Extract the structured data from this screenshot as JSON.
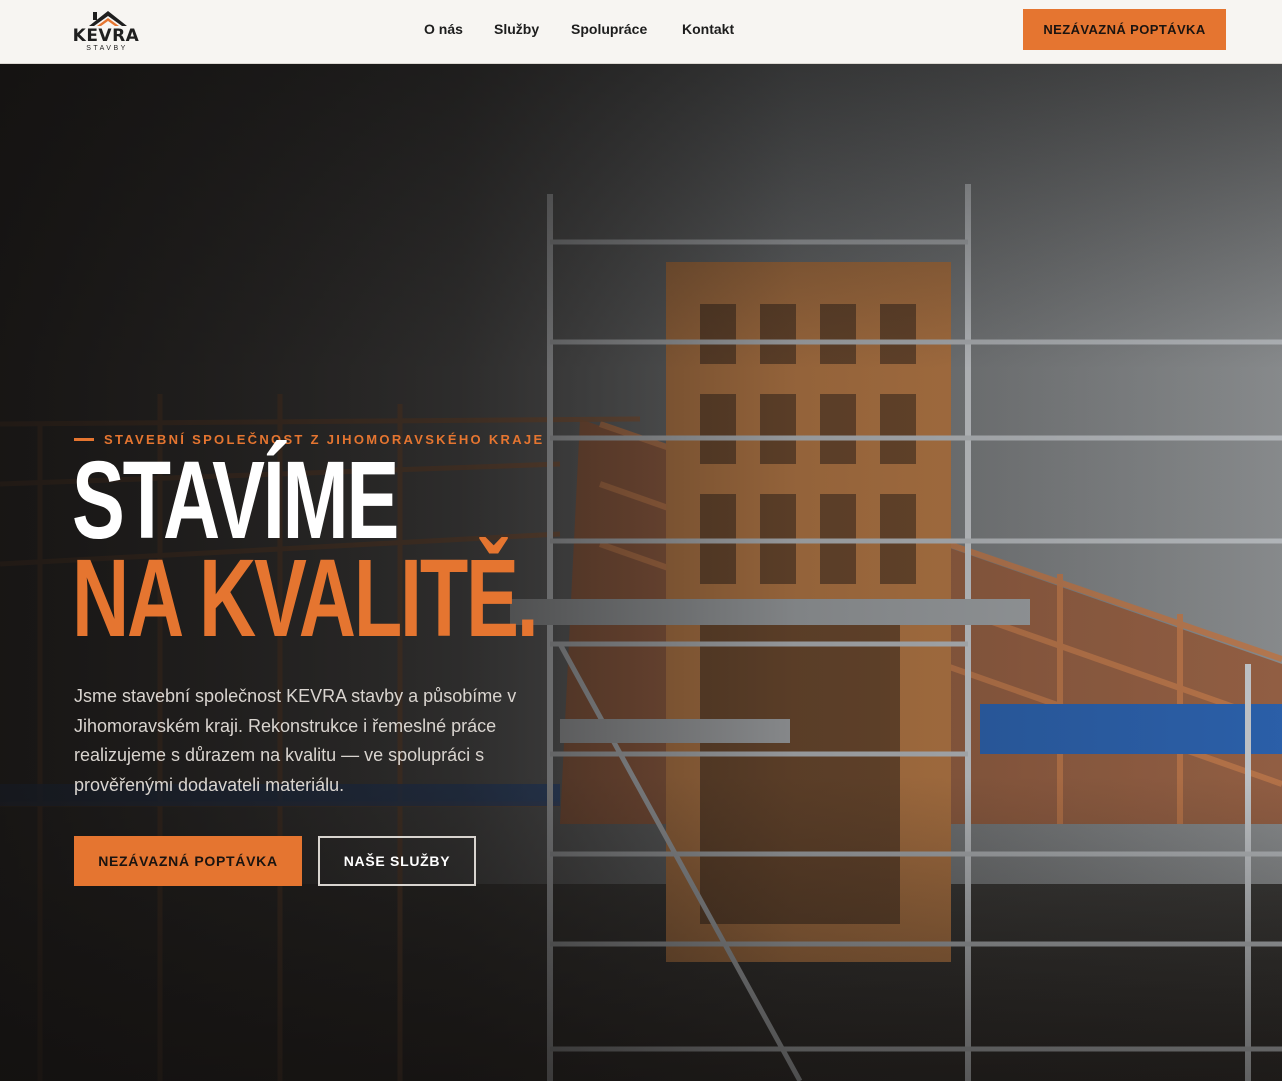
{
  "brand": {
    "name": "KEVRA",
    "subtitle": "STAVBY",
    "logo_icon": "roof-house-icon"
  },
  "nav": {
    "items": [
      {
        "label": "O nás"
      },
      {
        "label": "Služby"
      },
      {
        "label": "Spolupráce"
      },
      {
        "label": "Kontakt"
      }
    ],
    "cta_label": "NEZÁVAZNÁ POPTÁVKA"
  },
  "hero": {
    "eyebrow": "STAVEBNÍ SPOLEČNOST Z JIHOMORAVSKÉHO KRAJE",
    "headline_line1": "STAVÍME",
    "headline_line2": "NA KVALITĚ.",
    "intro": "Jsme stavební společnost KEVRA stavby a působíme v Jihomoravském kraji. Rekonstrukce i řemeslné práce realizujeme s důrazem na kvalitu — ve spolupráci s prověřenými dodavateli materiálu.",
    "primary_cta": "NEZÁVAZNÁ POPTÁVKA",
    "secondary_cta": "NAŠE SLUŽBY",
    "background_image": "timber-frame-house-under-construction-with-scaffolding"
  },
  "colors": {
    "accent": "#e57530",
    "header_bg": "#f7f5f2",
    "text_dark": "#1d1d1d",
    "text_light": "#ffffff"
  }
}
